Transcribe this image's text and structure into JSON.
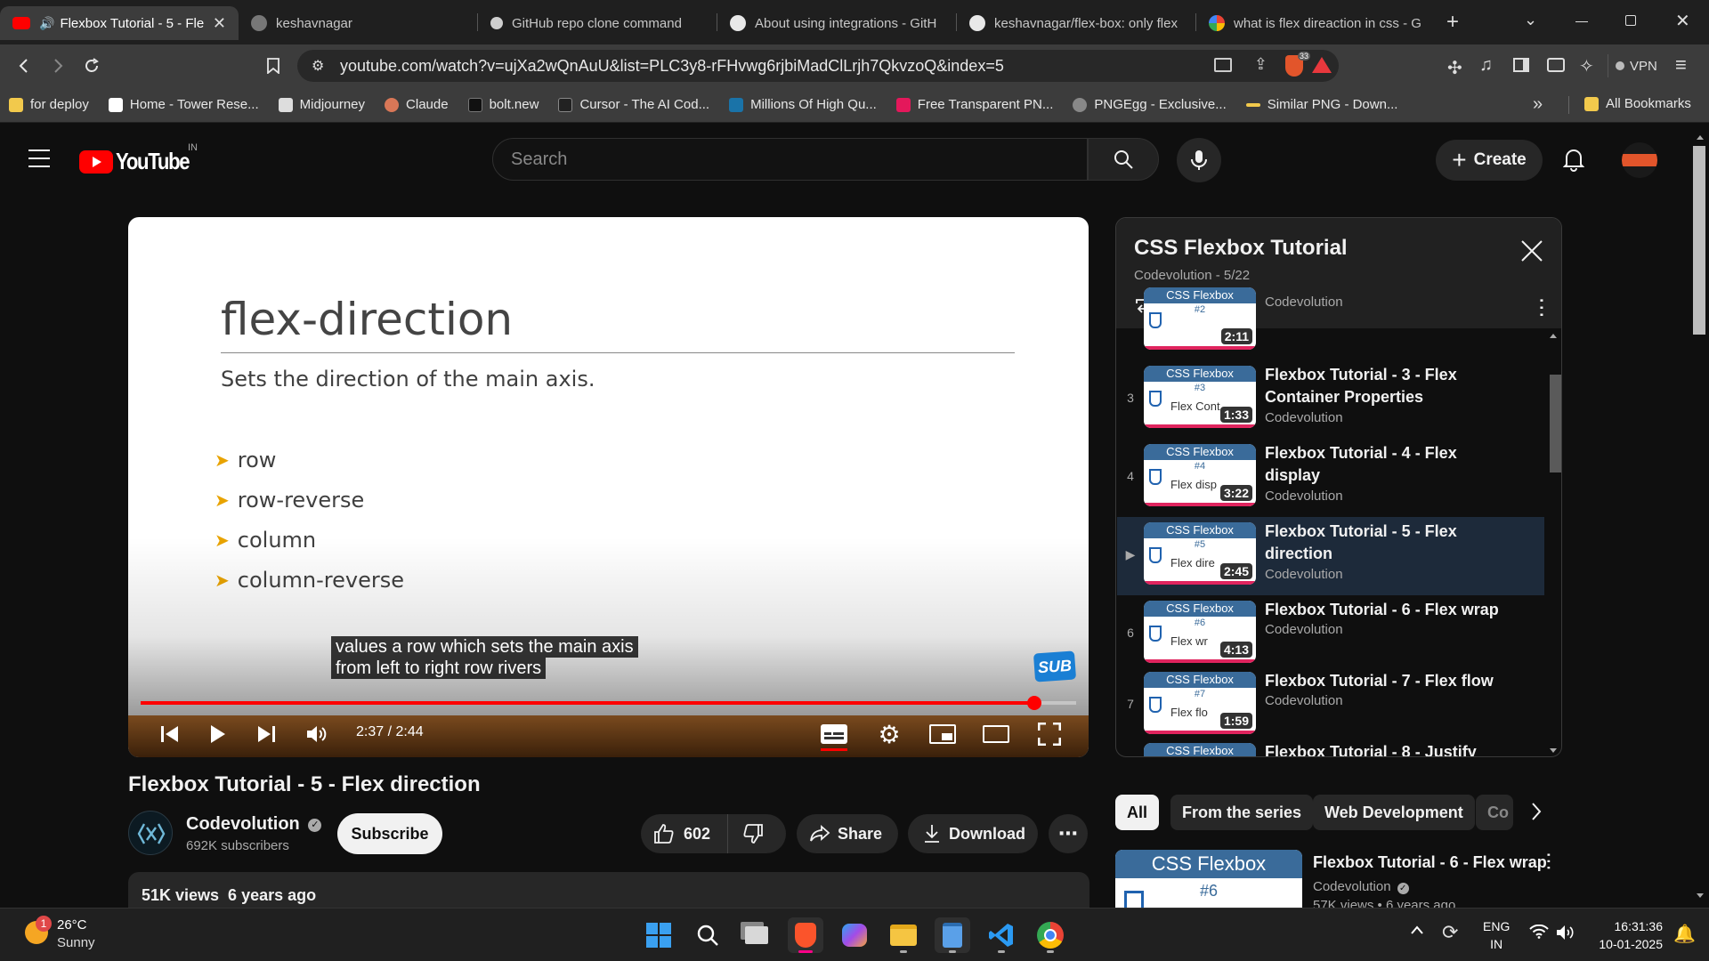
{
  "browser": {
    "tabs": [
      {
        "title": "Flexbox Tutorial - 5 - Fle",
        "active": true,
        "favicon": "youtube-icon",
        "audio": true
      },
      {
        "title": "keshavnagar",
        "favicon": "github-icon"
      },
      {
        "title": "GitHub repo clone command",
        "favicon": "chatgpt-icon"
      },
      {
        "title": "About using integrations - GitH",
        "favicon": "github-icon"
      },
      {
        "title": "keshavnagar/flex-box: only flex",
        "favicon": "github-icon"
      },
      {
        "title": "what is flex direaction in css - G",
        "favicon": "google-icon"
      }
    ],
    "url": "youtube.com/watch?v=ujXa2wQnAuU&list=PLC3y8-rFHvwg6rjbiMadClLrjh7QkvzoQ&index=5",
    "brave_badge": "33",
    "vpn_label": "VPN",
    "bookmarks": [
      {
        "label": "for deploy",
        "icon": "folder-icon",
        "color": "#f2c94c"
      },
      {
        "label": "Home - Tower Rese...",
        "icon": "tower-icon",
        "color": "#ffffff"
      },
      {
        "label": "Midjourney",
        "icon": "midjourney-icon",
        "color": "#dddddd"
      },
      {
        "label": "Claude",
        "icon": "claude-icon",
        "color": "#d97757"
      },
      {
        "label": "bolt.new",
        "icon": "bolt-icon",
        "color": "#111111"
      },
      {
        "label": "Cursor - The AI Cod...",
        "icon": "cursor-icon",
        "color": "#222222"
      },
      {
        "label": "Millions Of High Qu...",
        "icon": "kp-icon",
        "color": "#1a73a8"
      },
      {
        "label": "Free Transparent PN...",
        "icon": "pk-icon",
        "color": "#e4185b"
      },
      {
        "label": "PNGEgg - Exclusive...",
        "icon": "pngegg-icon",
        "color": "#888888"
      },
      {
        "label": "Similar PNG - Down...",
        "icon": "similarpng-icon",
        "color": "#f2c94c"
      }
    ],
    "all_bookmarks": "All Bookmarks"
  },
  "youtube": {
    "logo_text": "YouTube",
    "country": "IN",
    "search_placeholder": "Search",
    "create_label": "Create"
  },
  "video": {
    "slide": {
      "title": "flex-direction",
      "subtitle": "Sets the direction of the main axis.",
      "bullets": [
        "row",
        "row-reverse",
        "column",
        "column-reverse"
      ]
    },
    "caption_lines": [
      "values a row which sets the main axis",
      "from left to right row rivers"
    ],
    "sub_badge": "SUB",
    "time": "2:37 / 2:44",
    "progress_fraction": 0.955,
    "title": "Flexbox Tutorial - 5 - Flex direction"
  },
  "channel": {
    "name": "Codevolution",
    "subscribers": "692K subscribers",
    "subscribe_label": "Subscribe",
    "likes": "602",
    "share_label": "Share",
    "download_label": "Download"
  },
  "description": {
    "stats": "51K views  6 years ago"
  },
  "playlist": {
    "title": "CSS Flexbox Tutorial",
    "meta": "Codevolution - 5/22",
    "items": [
      {
        "index": "",
        "title": "",
        "channel": "Codevolution",
        "duration": "2:11",
        "thumb_num": "#2",
        "thumb_sub": ""
      },
      {
        "index": "3",
        "title": "Flexbox Tutorial - 3 - Flex Container Properties",
        "channel": "Codevolution",
        "duration": "1:33",
        "thumb_num": "#3",
        "thumb_sub": "Flex Cont"
      },
      {
        "index": "4",
        "title": "Flexbox Tutorial - 4 - Flex display",
        "channel": "Codevolution",
        "duration": "3:22",
        "thumb_num": "#4",
        "thumb_sub": "Flex disp"
      },
      {
        "index": "▶",
        "title": "Flexbox Tutorial - 5 - Flex direction",
        "channel": "Codevolution",
        "duration": "2:45",
        "thumb_num": "#5",
        "thumb_sub": "Flex dire",
        "current": true
      },
      {
        "index": "6",
        "title": "Flexbox Tutorial - 6 - Flex wrap",
        "channel": "Codevolution",
        "duration": "4:13",
        "thumb_num": "#6",
        "thumb_sub": "Flex wr"
      },
      {
        "index": "7",
        "title": "Flexbox Tutorial - 7 - Flex flow",
        "channel": "Codevolution",
        "duration": "1:59",
        "thumb_num": "#7",
        "thumb_sub": "Flex flo"
      },
      {
        "index": "",
        "title": "Flexbox Tutorial - 8 - Justify",
        "channel": "",
        "duration": "",
        "thumb_num": "",
        "thumb_sub": ""
      }
    ],
    "thumb_label": "CSS Flexbox"
  },
  "chips": [
    "All",
    "From the series",
    "Web Development",
    "Co"
  ],
  "recommendation": {
    "thumb_title": "CSS Flexbox",
    "thumb_num": "#6",
    "title": "Flexbox Tutorial - 6 - Flex wrap",
    "channel": "Codevolution",
    "stats": "57K views  • 6 years ago"
  },
  "taskbar": {
    "weather_temp": "26°C",
    "weather_desc": "Sunny",
    "weather_badge": "1",
    "lang_top": "ENG",
    "lang_bottom": "IN",
    "time": "16:31:36",
    "date": "10-01-2025"
  }
}
